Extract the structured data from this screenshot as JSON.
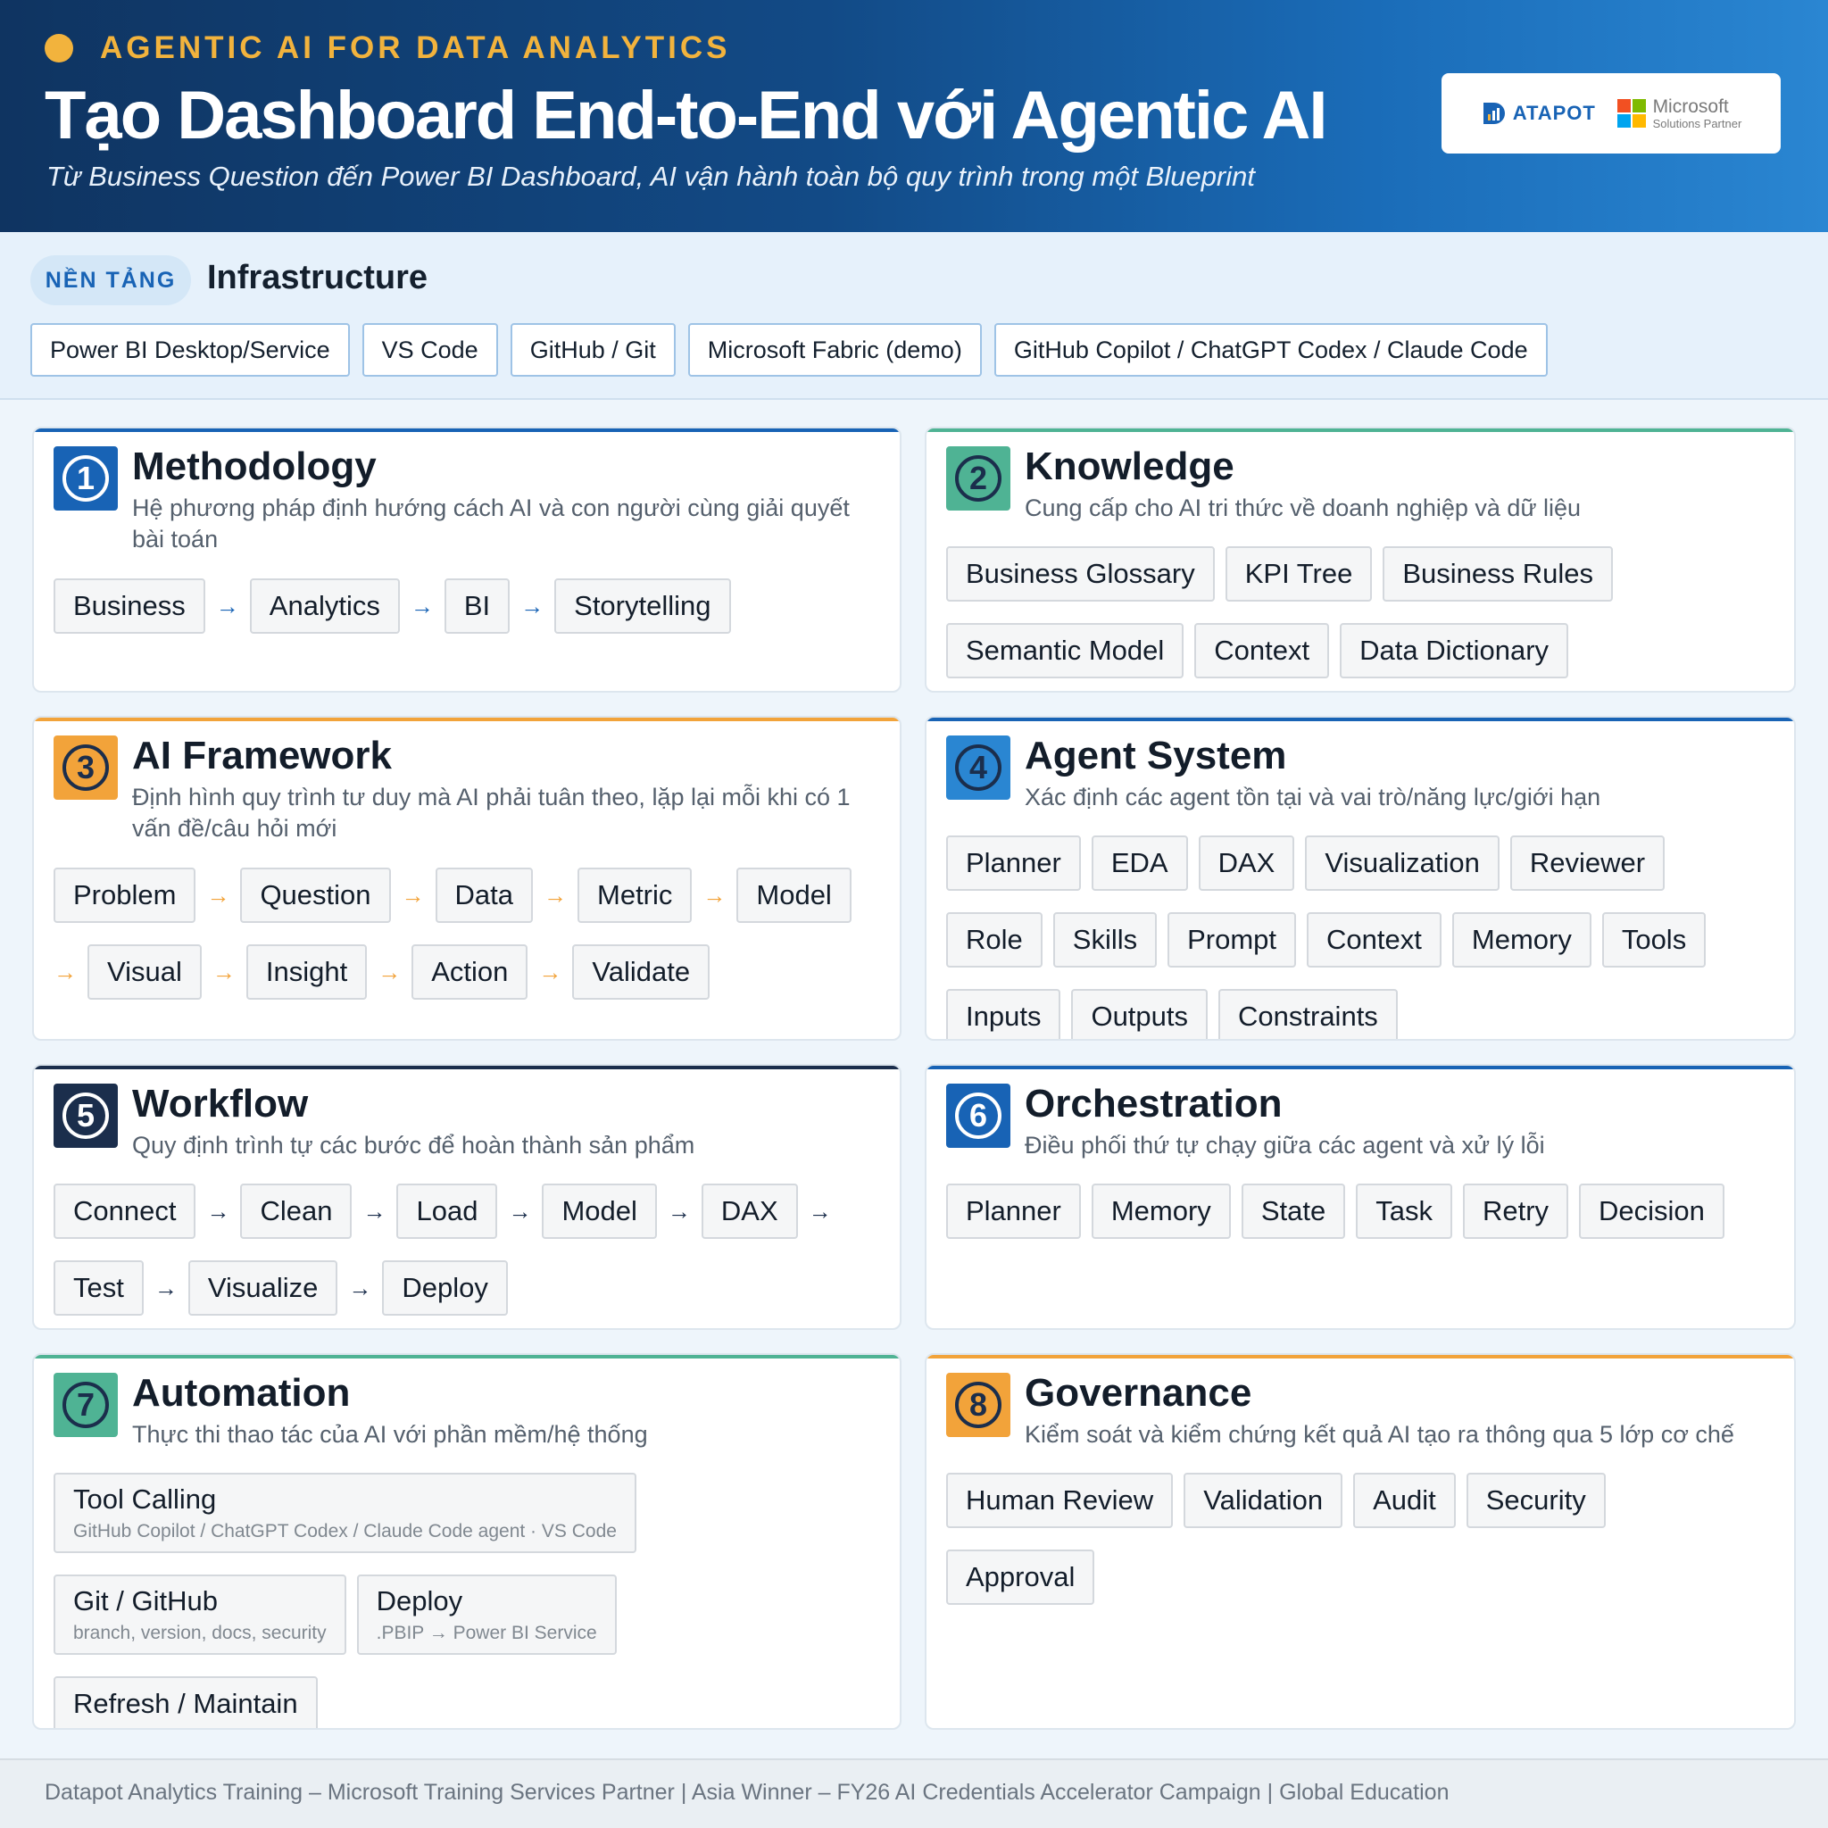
{
  "header": {
    "kicker": "AGENTIC AI FOR DATA ANALYTICS",
    "title": "Tạo Dashboard End-to-End với Agentic AI",
    "subtitle": "Từ Business Question đến Power BI Dashboard, AI vận hành toàn bộ quy trình trong một Blueprint",
    "logo_datapot": "ATAPOT",
    "logo_ms_name": "Microsoft",
    "logo_ms_sub": "Solutions Partner"
  },
  "infrastructure": {
    "pill": "NỀN TẢNG",
    "title": "Infrastructure",
    "tags": [
      "Power BI Desktop/Service",
      "VS Code",
      "GitHub / Git",
      "Microsoft Fabric (demo)",
      "GitHub Copilot / ChatGPT Codex / Claude Code"
    ]
  },
  "cards": {
    "methodology": {
      "number": "1",
      "title": "Methodology",
      "desc": "Hệ phương pháp định hướng cách AI và con người cùng giải quyết bài toán",
      "steps": [
        "Business",
        "Analytics",
        "BI",
        "Storytelling"
      ],
      "arrow": "→"
    },
    "knowledge": {
      "number": "2",
      "title": "Knowledge",
      "desc": "Cung cấp cho AI tri thức về doanh nghiệp và dữ liệu",
      "items": [
        "Business Glossary",
        "KPI Tree",
        "Business Rules",
        "Semantic Model",
        "Context",
        "Data Dictionary"
      ]
    },
    "framework": {
      "number": "3",
      "title": "AI Framework",
      "desc": "Định hình quy trình tư duy mà AI phải tuân theo, lặp lại mỗi khi có 1 vấn đề/câu hỏi mới",
      "steps": [
        "Problem",
        "Question",
        "Data",
        "Metric",
        "Model",
        "Visual",
        "Insight",
        "Action",
        "Validate"
      ],
      "arrow": "→"
    },
    "agent": {
      "number": "4",
      "title": "Agent System",
      "desc": "Xác định các agent tồn tại và vai trò/năng lực/giới hạn",
      "items": [
        "Planner",
        "EDA",
        "DAX",
        "Visualization",
        "Reviewer",
        "Role",
        "Skills",
        "Prompt",
        "Context",
        "Memory",
        "Tools",
        "Inputs",
        "Outputs",
        "Constraints"
      ]
    },
    "workflow": {
      "number": "5",
      "title": "Workflow",
      "desc": "Quy định trình tự các bước để hoàn thành sản phẩm",
      "steps": [
        "Connect",
        "Clean",
        "Load",
        "Model",
        "DAX",
        "Test",
        "Visualize",
        "Deploy"
      ],
      "arrow": "→"
    },
    "orchestration": {
      "number": "6",
      "title": "Orchestration",
      "desc": "Điều phối thứ tự chạy giữa các agent và xử lý lỗi",
      "items": [
        "Planner",
        "Memory",
        "State",
        "Task",
        "Retry",
        "Decision"
      ]
    },
    "automation": {
      "number": "7",
      "title": "Automation",
      "desc": "Thực thi thao tác của AI với phần mềm/hệ thống",
      "tools": [
        {
          "title": "Tool Calling",
          "sub": "GitHub Copilot / ChatGPT Codex / Claude Code agent · VS Code"
        },
        {
          "title": "Git / GitHub",
          "sub": "branch, version, docs, security"
        },
        {
          "title": "Deploy",
          "sub": ".PBIP → Power BI Service"
        },
        {
          "title": "Refresh / Maintain",
          "sub": ""
        }
      ]
    },
    "governance": {
      "number": "8",
      "title": "Governance",
      "desc": "Kiểm soát và kiểm chứng kết quả AI tạo ra thông qua 5 lớp cơ chế",
      "items": [
        "Human Review",
        "Validation",
        "Audit",
        "Security",
        "Approval"
      ]
    }
  },
  "colors": {
    "blue": "#1863b5",
    "teal": "#4fb394",
    "orange": "#f2a33a",
    "navy": "#1b2e4c",
    "gold": "#f2b33d"
  },
  "footer": {
    "text": "Datapot Analytics Training – Microsoft Training Services Partner | Asia Winner – FY26 AI Credentials Accelerator Campaign | Global Education"
  }
}
